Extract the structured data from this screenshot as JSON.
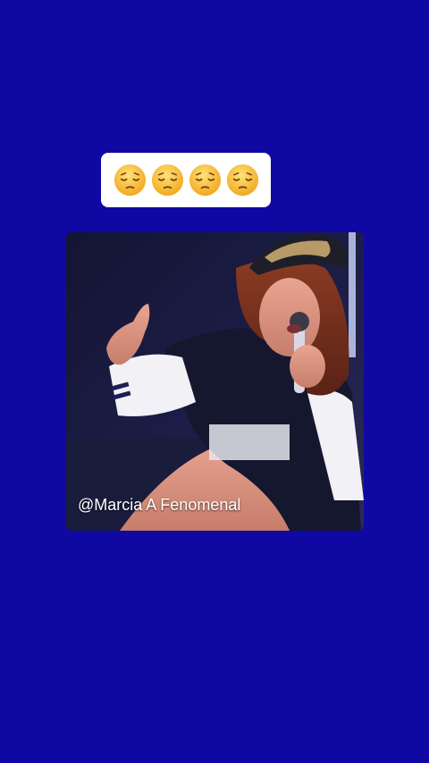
{
  "caption": {
    "emojis": [
      "pensive-face",
      "pensive-face",
      "pensive-face",
      "pensive-face"
    ]
  },
  "video": {
    "watermark": "@Marcia A Fenomenal"
  },
  "colors": {
    "background": "#1008a3",
    "caption_bg": "#ffffff",
    "emoji_face": "#f7c23a"
  }
}
